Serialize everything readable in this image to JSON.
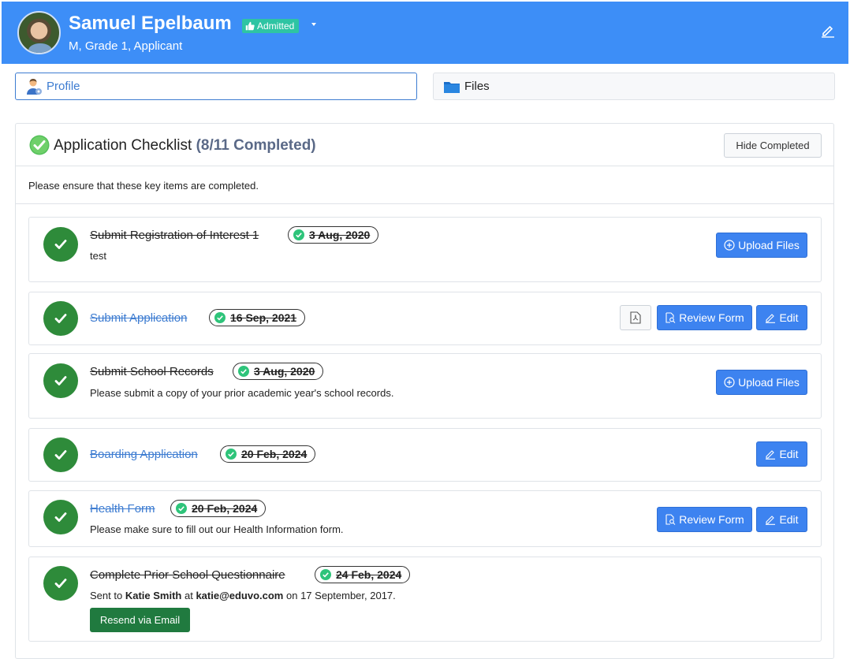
{
  "header": {
    "name": "Samuel Epelbaum",
    "status": "Admitted",
    "subtitle": "M, Grade 1, Applicant"
  },
  "tabs": [
    {
      "label": "Profile",
      "active": true
    },
    {
      "label": "Files",
      "active": false
    }
  ],
  "checklist": {
    "title": "Application Checklist",
    "count": "(8/11 Completed)",
    "hide_label": "Hide Completed",
    "note": "Please ensure that these key items are completed.",
    "items": [
      {
        "title": "Submit Registration of Interest 1",
        "date": "3 Aug, 2020",
        "desc": "test"
      },
      {
        "title": "Submit Application",
        "date": "16 Sep, 2021"
      },
      {
        "title": "Submit School Records",
        "date": "3 Aug, 2020",
        "desc": "Please submit a copy of your prior academic year's school records."
      },
      {
        "title": "Boarding Application",
        "date": "20 Feb, 2024"
      },
      {
        "title": "Health Form",
        "date": "20 Feb, 2024",
        "desc": "Please make sure to fill out our Health Information form."
      },
      {
        "title": "Complete Prior School Questionnaire",
        "date": "24 Feb, 2024",
        "sent_prefix": "Sent to",
        "sent_name": "Katie Smith",
        "sent_at": "at",
        "sent_email": "katie@eduvo.com",
        "sent_suffix": "on 17 September, 2017.",
        "resend_label": "Resend via Email"
      }
    ]
  },
  "buttons": {
    "upload_files": "Upload Files",
    "review_form": "Review Form",
    "edit": "Edit"
  },
  "colors": {
    "header_bg": "#3d8ef7",
    "primary": "#3d83f0",
    "done_green": "#2e8b3a",
    "admitted_badge": "#2ec4a3",
    "resend_green": "#207a3f"
  }
}
